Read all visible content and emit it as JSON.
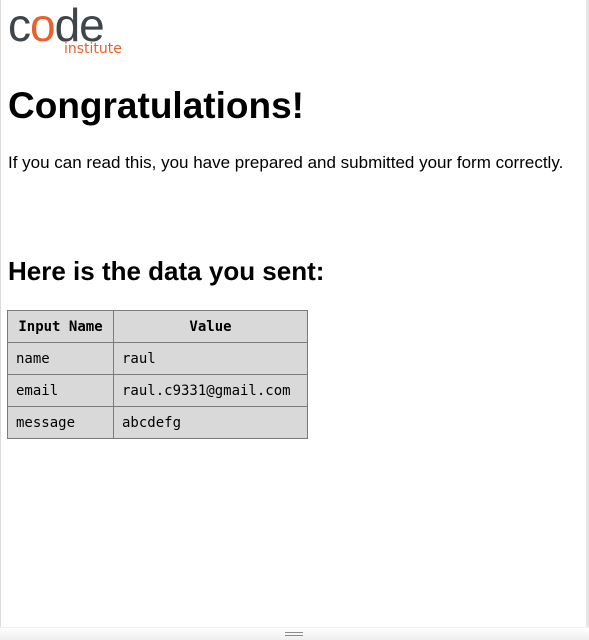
{
  "logo": {
    "c": "c",
    "o": "o",
    "de": "de",
    "subtitle": "institute"
  },
  "heading": "Congratulations!",
  "intro": "If you can read this, you have prepared and submitted your form correctly.",
  "subheading": "Here is the data you sent:",
  "table": {
    "headers": [
      "Input Name",
      "Value"
    ],
    "rows": [
      {
        "name": "name",
        "value": "raul"
      },
      {
        "name": "email",
        "value": "raul.c9331@gmail.com"
      },
      {
        "name": "message",
        "value": "abcdefg"
      }
    ]
  },
  "colors": {
    "brand_dark": "#3f4549",
    "brand_orange": "#e8612c",
    "table_bg": "#d9d9d9"
  }
}
